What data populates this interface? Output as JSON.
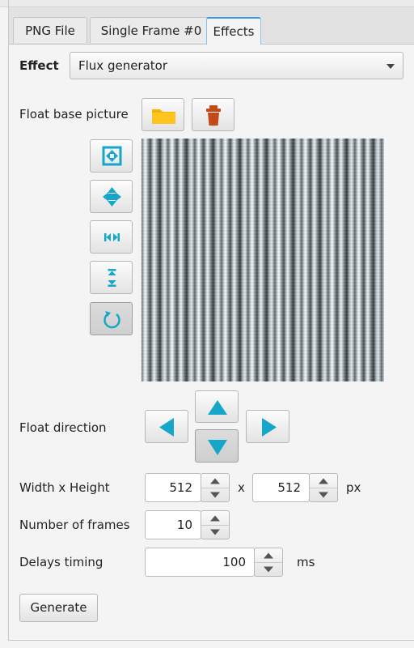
{
  "tabs": [
    {
      "label": "PNG File"
    },
    {
      "label": "Single Frame #0"
    },
    {
      "label": "Effects"
    }
  ],
  "effect": {
    "label": "Effect",
    "selected": "Flux generator"
  },
  "float_base_picture": {
    "label": "Float base picture",
    "open_icon": "folder-icon",
    "delete_icon": "trash-icon"
  },
  "side_tools": [
    "fit-all-icon",
    "fit-both-icon",
    "fit-horizontal-icon",
    "fit-vertical-icon",
    "rotate-icon"
  ],
  "float_direction": {
    "label": "Float direction",
    "selected": "down"
  },
  "size": {
    "label": "Width x Height",
    "width": "512",
    "height": "512",
    "separator": "x",
    "unit": "px"
  },
  "frames": {
    "label": "Number of frames",
    "value": "10"
  },
  "delay": {
    "label": "Delays timing",
    "value": "100",
    "unit": "ms"
  },
  "generate_label": "Generate",
  "colors": {
    "accent": "#16a6c9",
    "tab_active": "#3d9ae0",
    "trash": "#c24a17",
    "folder": "#f6b400"
  }
}
